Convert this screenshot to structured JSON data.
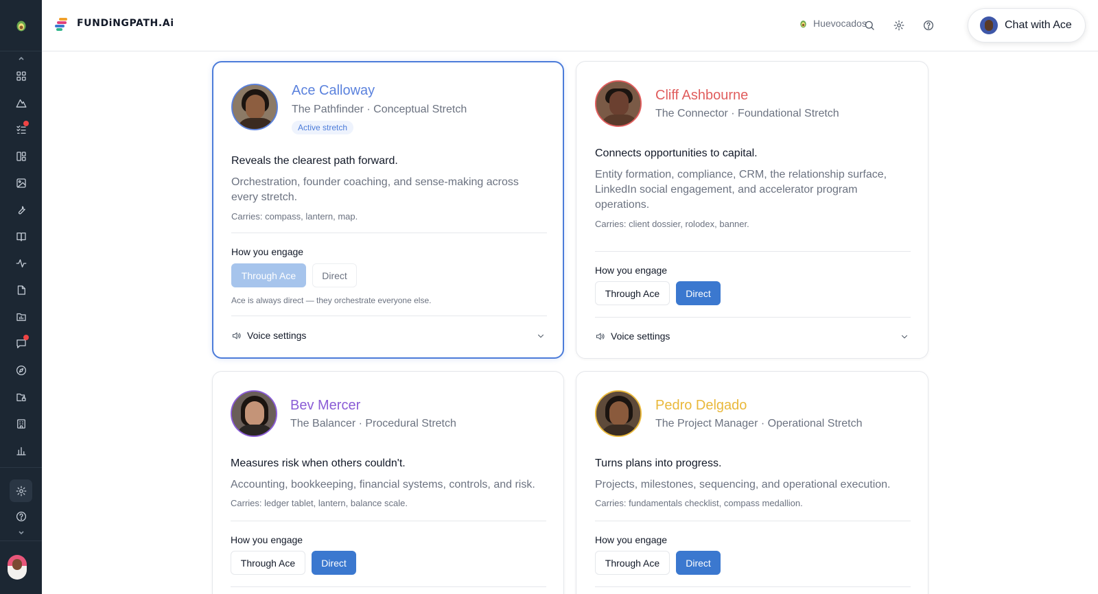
{
  "header": {
    "brand": "FUNDiNGPATH.Ai",
    "user_name": "Huevocados",
    "chat_button": "Chat with Ace"
  },
  "icons": {
    "sidebar": [
      "dashboard-icon",
      "mountain-icon",
      "tasks-icon",
      "layout-icon",
      "image-icon",
      "wrench-icon",
      "book-icon",
      "activity-icon",
      "document-icon",
      "folder-chart-icon",
      "chat-icon",
      "compass-icon",
      "folder-lock-icon",
      "building-icon",
      "bar-chart-icon",
      "settings-icon",
      "help-icon"
    ],
    "header": [
      "search-icon",
      "gear-icon",
      "help-icon"
    ]
  },
  "colors": {
    "accent": "#3b78cf",
    "ace": "#5b82dd",
    "cliff": "#e05d5d",
    "bev": "#8a5cd6",
    "pedro": "#e9b83a",
    "sidebar_bg": "#1c2733",
    "notification": "#ef4444"
  },
  "cards": [
    {
      "name": "Ace Calloway",
      "role": "The Pathfinder · Conceptual Stretch",
      "badge": "Active stretch",
      "tagline": "Reveals the clearest path forward.",
      "description": "Orchestration, founder coaching, and sense-making across every stretch.",
      "carries": "Carries: compass, lantern, map.",
      "engage_label": "How you engage",
      "option_through": "Through Ace",
      "option_direct": "Direct",
      "selected": "Through Ace",
      "note": "Ace is always direct — they orchestrate everyone else.",
      "voice_label": "Voice settings"
    },
    {
      "name": "Cliff Ashbourne",
      "role": "The Connector · Foundational Stretch",
      "tagline": "Connects opportunities to capital.",
      "description": "Entity formation, compliance, CRM, the relationship surface, LinkedIn social engagement, and accelerator program operations.",
      "carries": "Carries: client dossier, rolodex, banner.",
      "engage_label": "How you engage",
      "option_through": "Through Ace",
      "option_direct": "Direct",
      "selected": "Direct",
      "voice_label": "Voice settings"
    },
    {
      "name": "Bev Mercer",
      "role": "The Balancer · Procedural Stretch",
      "tagline": "Measures risk when others couldn't.",
      "description": "Accounting, bookkeeping, financial systems, controls, and risk.",
      "carries": "Carries: ledger tablet, lantern, balance scale.",
      "engage_label": "How you engage",
      "option_through": "Through Ace",
      "option_direct": "Direct",
      "selected": "Direct"
    },
    {
      "name": "Pedro Delgado",
      "role": "The Project Manager · Operational Stretch",
      "tagline": "Turns plans into progress.",
      "description": "Projects, milestones, sequencing, and operational execution.",
      "carries": "Carries: fundamentals checklist, compass medallion.",
      "engage_label": "How you engage",
      "option_through": "Through Ace",
      "option_direct": "Direct",
      "selected": "Direct"
    }
  ]
}
